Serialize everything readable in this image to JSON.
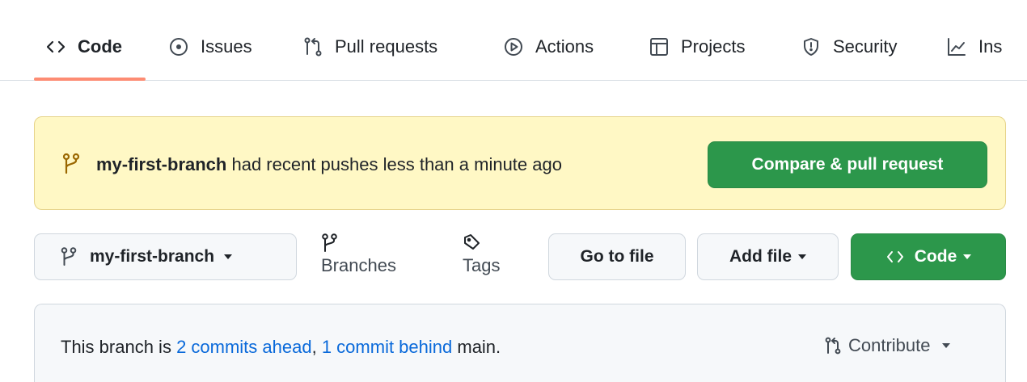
{
  "nav": {
    "tabs": [
      {
        "label": "Code",
        "icon": "code-icon",
        "active": true
      },
      {
        "label": "Issues",
        "icon": "issue-opened-icon",
        "active": false
      },
      {
        "label": "Pull requests",
        "icon": "git-pull-request-icon",
        "active": false
      },
      {
        "label": "Actions",
        "icon": "play-icon",
        "active": false
      },
      {
        "label": "Projects",
        "icon": "table-icon",
        "active": false
      },
      {
        "label": "Security",
        "icon": "shield-icon",
        "active": false
      },
      {
        "label": "Ins",
        "icon": "graph-icon",
        "active": false
      }
    ],
    "active_underline_color": "#fd8c73"
  },
  "banner": {
    "branch": "my-first-branch",
    "message": " had recent pushes less than a minute ago",
    "button_label": "Compare & pull request",
    "background": "#fff8c5",
    "icon": "git-branch-icon"
  },
  "toolbar": {
    "branch_selector": "my-first-branch",
    "branches_label": "Branches",
    "tags_label": "Tags",
    "go_to_file_label": "Go to file",
    "add_file_label": "Add file",
    "code_button_label": "Code",
    "accent": "#2c974b"
  },
  "ahead_behind": {
    "prefix": "This branch is ",
    "ahead_link": "2 commits ahead",
    "separator": ", ",
    "behind_link": "1 commit behind",
    "suffix": " main.",
    "contribute_label": "Contribute",
    "link_color": "#0969da"
  }
}
